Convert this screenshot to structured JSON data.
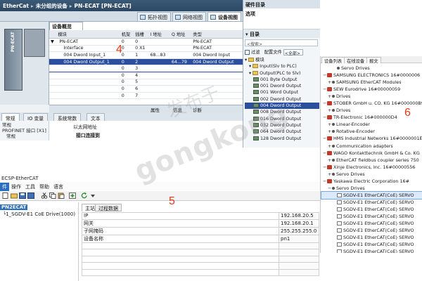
{
  "tia": {
    "title_parts": [
      "EtherCat",
      "未分组的设备",
      "PN-ECAT [PN-ECAT]"
    ],
    "view_tabs": [
      "拓扑视图",
      "网络视图",
      "设备视图"
    ],
    "device_label": "PN-ECAT",
    "overview_tab": "设备概览",
    "table": {
      "headers": [
        "",
        "模块",
        "机架",
        "插槽",
        "I 地址",
        "Q 地址",
        "类型"
      ],
      "rows": [
        [
          "▼",
          "PN-ECAT",
          "0",
          "0",
          "",
          "",
          "PN-ECAT"
        ],
        [
          "",
          "Interface",
          "0",
          "0 X1",
          "",
          "",
          "PN-ECAT"
        ],
        [
          "",
          "004 Dword Input_1",
          "0",
          "1",
          "68...83",
          "",
          "004 Dword Input"
        ],
        [
          "",
          "004 Dword Output_1",
          "0",
          "2",
          "",
          "64...79",
          "004 Dword Output"
        ],
        [
          "",
          "",
          "0",
          "3",
          "",
          "",
          ""
        ],
        [
          "",
          "",
          "0",
          "4",
          "",
          "",
          ""
        ],
        [
          "",
          "",
          "0",
          "5",
          "",
          "",
          ""
        ],
        [
          "",
          "",
          "0",
          "6",
          "",
          "",
          ""
        ],
        [
          "",
          "",
          "0",
          "7",
          "",
          "",
          ""
        ]
      ]
    },
    "callout_number": "4",
    "prop_buttons": [
      "属性",
      "信息",
      "诊断"
    ],
    "prop_tabs": [
      "常规",
      "IO 变量",
      "系统常数",
      "文本"
    ],
    "prop_side": [
      "常规",
      "PROFINET 接口 [X1]",
      "常规"
    ],
    "prop_right": [
      "以太网地址",
      "接口连接到"
    ]
  },
  "hw_catalog": {
    "title": "硬件目录",
    "options": "选项",
    "catalog": "目录",
    "search_placeholder": "<搜索>",
    "filter_label": "过滤",
    "profile_label": "配置文件",
    "profile_value": "<全部>",
    "tree": [
      {
        "label": "模块",
        "kind": "folder",
        "indent": 0
      },
      {
        "label": "Input(Slv to PLC)",
        "kind": "folder",
        "indent": 1
      },
      {
        "label": "Output(PLC to Slv)",
        "kind": "folder",
        "indent": 1
      },
      {
        "label": "001 Byte Output",
        "kind": "module",
        "indent": 2
      },
      {
        "label": "001 Dword Output",
        "kind": "module",
        "indent": 2
      },
      {
        "label": "001 Word Output",
        "kind": "module",
        "indent": 2
      },
      {
        "label": "002 Dword Output",
        "kind": "module",
        "indent": 2
      },
      {
        "label": "004 Dword Output",
        "kind": "module",
        "indent": 2,
        "selected": true
      },
      {
        "label": "008 Dword Output",
        "kind": "module",
        "indent": 2
      },
      {
        "label": "016 Dword Output",
        "kind": "module",
        "indent": 2
      },
      {
        "label": "032 Dword Output",
        "kind": "module",
        "indent": 2
      },
      {
        "label": "064 Dword Output",
        "kind": "module",
        "indent": 2
      },
      {
        "label": "128 Dword Output",
        "kind": "module",
        "indent": 2
      }
    ]
  },
  "ecsp": {
    "title": "ECSP-EtherCAT",
    "menu": [
      "件",
      "操作",
      "工具",
      "帮助",
      "语言"
    ],
    "tree_root": "PN2ECAT",
    "tree_child": "1_SGDV-E1 CoE Drive(1000)",
    "tabs": [
      "主站",
      "过程数据"
    ],
    "grid": [
      {
        "key": "IP",
        "value": "192.168.20.5"
      },
      {
        "key": "网关",
        "value": "192.168.20.1"
      },
      {
        "key": "子网掩码",
        "value": "255.255.255.0"
      },
      {
        "key": "设备名称",
        "value": "pn1"
      },
      {
        "key": "",
        "value": ""
      },
      {
        "key": "",
        "value": ""
      },
      {
        "key": "",
        "value": ""
      },
      {
        "key": "",
        "value": ""
      },
      {
        "key": "",
        "value": ""
      }
    ],
    "callout_number": "5"
  },
  "device_list": {
    "tabs": [
      "设备列表",
      "在线设备",
      "报文"
    ],
    "rows": [
      {
        "exp": "",
        "text": "Servo Drives",
        "indent": 2,
        "icon": "drive"
      },
      {
        "exp": "−",
        "text": "SAMSUNG ELECTRONICS   16#0000006",
        "indent": 0,
        "icon": "vendor"
      },
      {
        "exp": "+",
        "text": "SAMSUNG EtherCAT Modules",
        "indent": 1,
        "icon": "drive"
      },
      {
        "exp": "−",
        "text": "SEW Eurodrive   16#00000059",
        "indent": 0,
        "icon": "vendor"
      },
      {
        "exp": "+",
        "text": "Drives",
        "indent": 1,
        "icon": "drive"
      },
      {
        "exp": "−",
        "text": "STOBER GmbH u. CO. KG   16#000000B9",
        "indent": 0,
        "icon": "vendor"
      },
      {
        "exp": "+",
        "text": "Drives",
        "indent": 1,
        "icon": "drive"
      },
      {
        "exp": "−",
        "text": "TR-Electronic   16#000000D4",
        "indent": 0,
        "icon": "vendor"
      },
      {
        "exp": "+",
        "text": "Linear-Encoder",
        "indent": 1,
        "icon": "drive"
      },
      {
        "exp": "+",
        "text": "Rotative-Encoder",
        "indent": 1,
        "icon": "drive"
      },
      {
        "exp": "−",
        "text": "HMS Industrial Networks   16#0000001E",
        "indent": 0,
        "icon": "vendor"
      },
      {
        "exp": "+",
        "text": "Communication adapters",
        "indent": 1,
        "icon": "drive"
      },
      {
        "exp": "−",
        "text": "WAGO Kontakttechnik GmbH & Co. KG",
        "indent": 0,
        "icon": "vendor"
      },
      {
        "exp": "+",
        "text": "EtherCAT fieldbus coupler series 750",
        "indent": 1,
        "icon": "drive"
      },
      {
        "exp": "−",
        "text": "Xinje Electronics, Inc.   16#00000556",
        "indent": 0,
        "icon": "vendor"
      },
      {
        "exp": "+",
        "text": "Servo Drives",
        "indent": 1,
        "icon": "drive"
      },
      {
        "exp": "−",
        "text": "Yaskawa Electric Corporation   16#",
        "indent": 0,
        "icon": "vendor"
      },
      {
        "exp": "−",
        "text": "Servo Drives",
        "indent": 1,
        "icon": "drive"
      },
      {
        "exp": "",
        "text": "SGDV-E1 EtherCAT(CoE) SERVO",
        "indent": 2,
        "icon": "slave",
        "selected": true
      },
      {
        "exp": "",
        "text": "SGDV-E1 EtherCAT(CoE) SERVO",
        "indent": 2,
        "icon": "slave"
      },
      {
        "exp": "",
        "text": "SGDV-E1 EtherCAT(CoE) SERVO",
        "indent": 2,
        "icon": "slave"
      },
      {
        "exp": "",
        "text": "SGDV-E1 EtherCAT(CoE) SERVO",
        "indent": 2,
        "icon": "slave"
      },
      {
        "exp": "",
        "text": "SGDV-E1 EtherCAT(CoE) SERVO",
        "indent": 2,
        "icon": "slave"
      },
      {
        "exp": "",
        "text": "SGDV-E1 EtherCAT(CoE) SERVO",
        "indent": 2,
        "icon": "slave"
      },
      {
        "exp": "",
        "text": "SGDV-E1 EtherCAT(CoE) SERVO",
        "indent": 2,
        "icon": "slave"
      },
      {
        "exp": "",
        "text": "SGDV-E1 EtherCAT(CoE) SERVO",
        "indent": 2,
        "icon": "slave"
      },
      {
        "exp": "",
        "text": "SGDV-E1 EtherCAT(CoE) SERVO",
        "indent": 2,
        "icon": "slave"
      }
    ],
    "callout_number": "6"
  },
  "watermark": {
    "line1": "发布于",
    "line2": "gongkong"
  },
  "colors": {
    "selection": "#2b4f9c",
    "callout": "#e23a16",
    "tia_title": "#2c4762"
  }
}
